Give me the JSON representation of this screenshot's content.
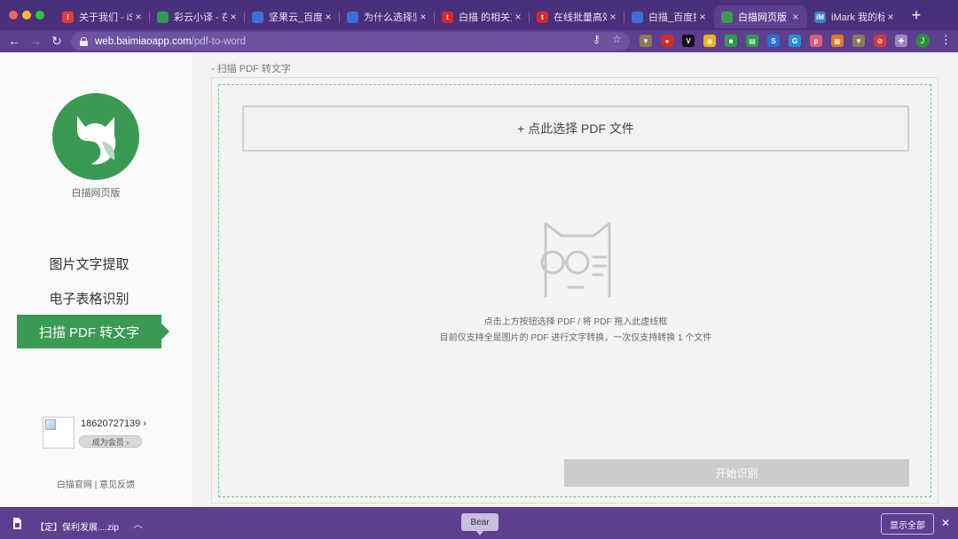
{
  "browser": {
    "tabs": [
      {
        "title": "关于我们 - iSlid",
        "favicon": "islide-icon",
        "color": "#e43b3b",
        "glyph": "i",
        "active": false
      },
      {
        "title": "彩云小译 - 在线",
        "favicon": "caiyun-icon",
        "color": "#2e9b4f",
        "glyph": "",
        "active": false
      },
      {
        "title": "坚果云_百度搜索",
        "favicon": "baidu-icon",
        "color": "#3d6fd8",
        "glyph": "",
        "active": false
      },
      {
        "title": "为什么选择坚果",
        "favicon": "baidu-icon",
        "color": "#3d6fd8",
        "glyph": "",
        "active": false
      },
      {
        "title": "白描 的相关文",
        "favicon": "toutiao-icon",
        "color": "#d4282d",
        "glyph": "t",
        "active": false
      },
      {
        "title": "在线批量高效",
        "favicon": "toutiao-icon",
        "color": "#d4282d",
        "glyph": "t",
        "active": false
      },
      {
        "title": "白描_百度搜索",
        "favicon": "baidu-icon",
        "color": "#3d6fd8",
        "glyph": "",
        "active": false
      },
      {
        "title": "白描网页版 - 白",
        "favicon": "baimiao-icon",
        "color": "#3a9a53",
        "glyph": "",
        "active": true
      },
      {
        "title": "iMark 我的标注",
        "favicon": "imark-icon",
        "color": "#3b82c4",
        "glyph": "iM",
        "active": false
      }
    ],
    "url": {
      "host": "web.baimiaoapp.com",
      "path": "/pdf-to-word"
    },
    "extensions": [
      {
        "name": "shield-icon",
        "color": "#8a7a55",
        "glyph": "▼"
      },
      {
        "name": "adblock-icon",
        "color": "#d42a2a",
        "glyph": "●"
      },
      {
        "name": "vimium-icon",
        "color": "#111111",
        "glyph": "V"
      },
      {
        "name": "chrome-ext-icon",
        "color": "#e8b21f",
        "glyph": "◉"
      },
      {
        "name": "evernote-icon",
        "color": "#2e9b4f",
        "glyph": "■"
      },
      {
        "name": "sheets-icon",
        "color": "#2e9b4f",
        "glyph": "▤"
      },
      {
        "name": "s-icon",
        "color": "#2a6fd6",
        "glyph": "S"
      },
      {
        "name": "globe-icon",
        "color": "#2a8fd6",
        "glyph": "G"
      },
      {
        "name": "p-icon",
        "color": "#e05a7a",
        "glyph": "p"
      },
      {
        "name": "palette-icon",
        "color": "#e07a22",
        "glyph": "▦"
      },
      {
        "name": "shield-icon",
        "color": "#8a7a55",
        "glyph": "▼"
      },
      {
        "name": "compass-icon",
        "color": "#d43a3a",
        "glyph": "⊘"
      },
      {
        "name": "puzzle-icon",
        "color": "#9a8ac0",
        "glyph": "✚"
      }
    ],
    "profile_initial": "J"
  },
  "sidebar": {
    "app_name": "白描网页版",
    "menu": [
      {
        "label": "图片文字提取",
        "active": false
      },
      {
        "label": "电子表格识别",
        "active": false
      },
      {
        "label": "扫描 PDF 转文字",
        "active": true
      }
    ],
    "user": {
      "phone": "18620727139 ›",
      "member_label": "成为会员 ›"
    },
    "footer": "白描官网 | 意见反馈"
  },
  "main": {
    "breadcrumb": "- 扫描 PDF 转文字",
    "select_button": "+ 点此选择 PDF 文件",
    "hint_line1": "点击上方按钮选择 PDF / 将 PDF 拖入此虚线框",
    "hint_line2": "目前仅支持全是图片的 PDF 进行文字转换，一次仅支持转换 1 个文件",
    "start_button": "开始识别"
  },
  "downloads": {
    "file_name": "【定】保利发展....zip",
    "tooltip": "Bear",
    "show_all": "显示全部"
  },
  "colors": {
    "accent": "#3a9a53",
    "browser_frame": "#5d3e8f"
  }
}
